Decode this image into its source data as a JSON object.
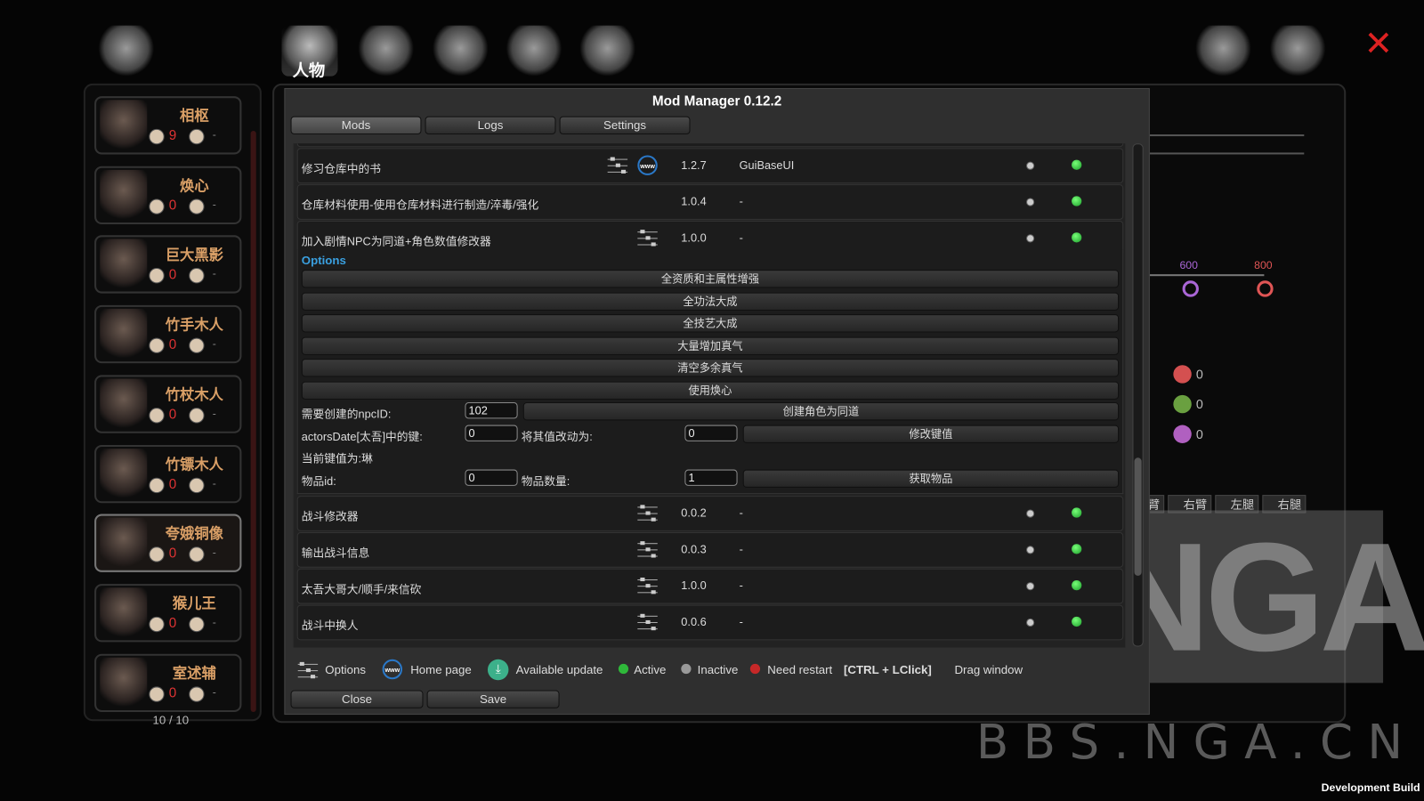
{
  "top_nav": {
    "active_tab_label": "人物",
    "icons": [
      "companions-icon",
      "character-icon",
      "martial-arts-icon",
      "buildings-icon",
      "beast-icon",
      "taiji-icon"
    ],
    "right_icons": [
      "library-icon",
      "hammer-icon",
      "close-icon"
    ]
  },
  "sidebar": {
    "characters": [
      {
        "name": "相枢",
        "value": "9",
        "extra": "-"
      },
      {
        "name": "焕心",
        "value": "0",
        "extra": "-"
      },
      {
        "name": "巨大黑影",
        "value": "0",
        "extra": "-"
      },
      {
        "name": "竹手木人",
        "value": "0",
        "extra": "-"
      },
      {
        "name": "竹杖木人",
        "value": "0",
        "extra": "-"
      },
      {
        "name": "竹镖木人",
        "value": "0",
        "extra": "-"
      },
      {
        "name": "夸娥铜像",
        "value": "0",
        "extra": "-",
        "selected": true
      },
      {
        "name": "猴儿王",
        "value": "0",
        "extra": "-"
      },
      {
        "name": "室述辅",
        "value": "0",
        "extra": "-"
      }
    ],
    "pager": "10 / 10"
  },
  "background": {
    "markers": [
      "600",
      "800"
    ],
    "gem_counts": [
      "0",
      "0",
      "0"
    ],
    "limbs": [
      "臂",
      "右臂",
      "左腿",
      "右腿"
    ]
  },
  "mod_manager": {
    "title": "Mod Manager 0.12.2",
    "tabs": [
      "Mods",
      "Logs",
      "Settings"
    ],
    "active_tab": "Mods",
    "mods": [
      {
        "name": "修习仓库中的书",
        "version": "1.2.7",
        "requirement": "GuiBaseUI",
        "has_options": true,
        "has_homepage": true,
        "status": "active"
      },
      {
        "name": "仓库材料使用-使用仓库材料进行制造/淬毒/强化",
        "version": "1.0.4",
        "requirement": "-",
        "has_options": false,
        "has_homepage": false,
        "status": "active"
      },
      {
        "name": "加入剧情NPC为同道+角色数值修改器",
        "version": "1.0.0",
        "requirement": "-",
        "has_options": true,
        "has_homepage": false,
        "status": "active",
        "expanded": true
      }
    ],
    "options": {
      "label": "Options",
      "buttons": [
        "全资质和主属性增强",
        "全功法大成",
        "全技艺大成",
        "大量增加真气",
        "清空多余真气",
        "使用焕心"
      ],
      "npc_id_label": "需要创建的npcID:",
      "npc_id_value": "102",
      "create_button": "创建角色为同道",
      "key_label": "actorsDate[太吾]中的键:",
      "key_value": "0",
      "change_to_label": "将其值改动为:",
      "change_to_value": "0",
      "modify_button": "修改键值",
      "current_value_text": "当前键值为:琳",
      "item_id_label": "物品id:",
      "item_id_value": "0",
      "item_count_label": "物品数量:",
      "item_count_value": "1",
      "get_item_button": "获取物品"
    },
    "mods_after": [
      {
        "name": "战斗修改器",
        "version": "0.0.2",
        "requirement": "-",
        "status": "active"
      },
      {
        "name": "输出战斗信息",
        "version": "0.0.3",
        "requirement": "-",
        "status": "active"
      },
      {
        "name": "太吾大哥大/顺手/来信砍",
        "version": "1.0.0",
        "requirement": "-",
        "status": "active"
      },
      {
        "name": "战斗中换人",
        "version": "0.0.6",
        "requirement": "-",
        "status": "active"
      }
    ],
    "legend": {
      "options": "Options",
      "home_page": "Home page",
      "update": "Available update",
      "active": "Active",
      "inactive": "Inactive",
      "restart": "Need restart",
      "shortcut": "[CTRL + LClick]",
      "shortcut_desc": "Drag window"
    },
    "colors": {
      "active": "#2fb83a",
      "inactive": "#999999",
      "restart": "#c62828",
      "accent": "#3aa0e0",
      "update": "#3cb08a"
    },
    "close_label": "Close",
    "save_label": "Save"
  },
  "watermark": {
    "site": "BBS.NGA.CN",
    "logo": "NGA"
  },
  "dev_build": "Development Build"
}
